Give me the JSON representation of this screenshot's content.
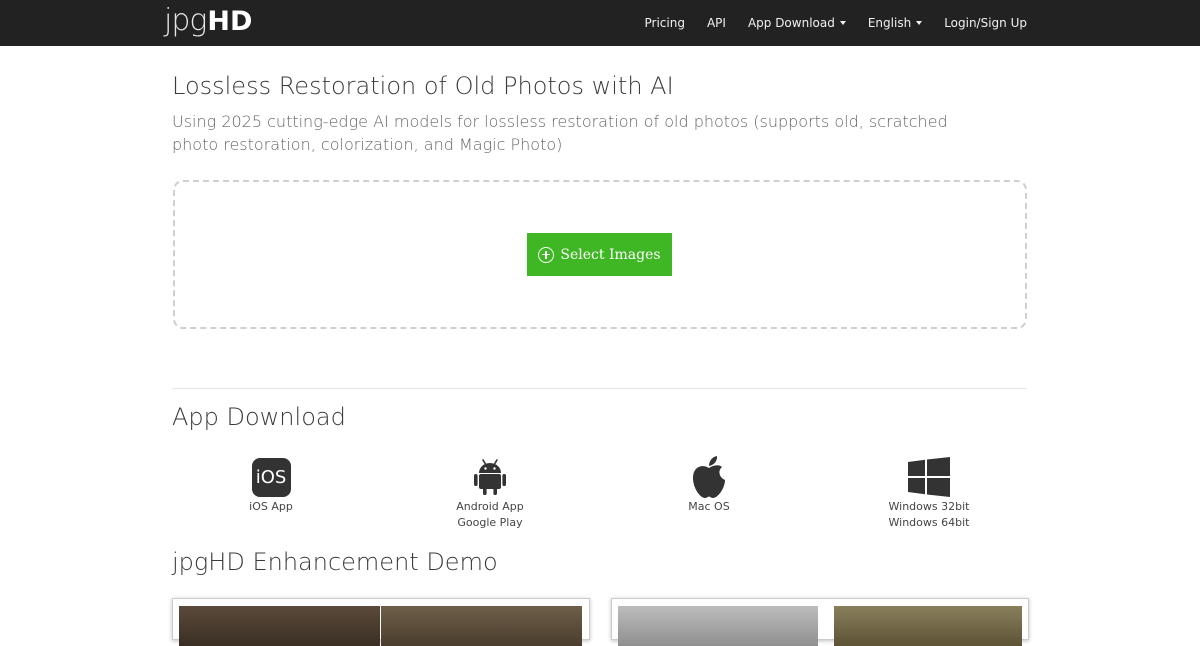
{
  "nav": {
    "logo_part1": "jpg",
    "logo_part2": "HD",
    "links": [
      "Pricing",
      "API",
      "App Download",
      "English",
      "Login/Sign Up"
    ]
  },
  "hero": {
    "title": "Lossless Restoration of Old Photos with AI",
    "subtitle": "Using 2025 cutting-edge AI models for lossless restoration of old photos (supports old, scratched photo restoration, colorization, and Magic Photo)"
  },
  "upload": {
    "button_label": "Select Images"
  },
  "app_download": {
    "title": "App Download",
    "apps": [
      {
        "icon": "ios-icon",
        "icon_text": "iOS",
        "lines": [
          "iOS App"
        ]
      },
      {
        "icon": "android-icon",
        "lines": [
          "Android App",
          "Google Play"
        ]
      },
      {
        "icon": "apple-icon",
        "lines": [
          "Mac OS"
        ]
      },
      {
        "icon": "windows-icon",
        "lines": [
          "Windows 32bit",
          "Windows 64bit"
        ]
      }
    ]
  },
  "demo": {
    "title": "jpgHD Enhancement Demo"
  },
  "colors": {
    "navbar_bg": "#222222",
    "accent_green": "#3fb623"
  }
}
